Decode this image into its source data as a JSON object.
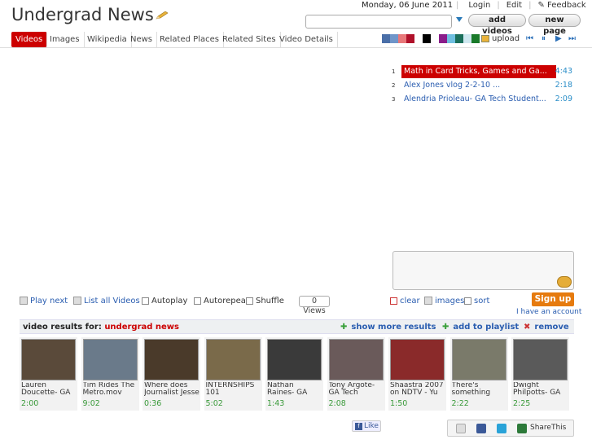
{
  "header": {
    "title": "Undergrad News",
    "date": "Monday, 06 June 2011",
    "links": [
      "Login",
      "Edit",
      "Feedback"
    ],
    "search_placeholder": "",
    "add_videos": "add videos",
    "new_page": "new page"
  },
  "tabs": [
    "Videos",
    "Images",
    "Wikipedia",
    "News",
    "Related Places",
    "Related Sites",
    "Video Details"
  ],
  "swatch_colors": [
    "#4a6fa8",
    "#6f95c9",
    "#e8787a",
    "#b0112a",
    "#ffffff",
    "#000000",
    "#ffffff",
    "#8a1d8a",
    "#6fbfe0",
    "#1a6f5a",
    "#cfe8f0",
    "#1a7a2a"
  ],
  "upload_label": "upload",
  "player_controls": [
    "⏮",
    "⏸",
    "▶",
    "⏭"
  ],
  "playlist": [
    {
      "num": "1",
      "title": "Math in Card Tricks, Games and Ga...",
      "duration": "4:43",
      "active": true
    },
    {
      "num": "2",
      "title": "Alex Jones vlog 2-2-10             ...",
      "duration": "2:18",
      "active": false
    },
    {
      "num": "3",
      "title": "Alendria Prioleau- GA Tech Student...",
      "duration": "2:09",
      "active": false
    }
  ],
  "controls": {
    "play_next": "Play next",
    "list_all": "List all Videos",
    "autoplay": "Autoplay",
    "autorepeat": "Autorepeat",
    "shuffle": "Shuffle",
    "views": "0 Views",
    "clear": "clear",
    "images": "images",
    "sort": "sort",
    "sign_up": "Sign up",
    "have_account": "I have an account"
  },
  "results": {
    "label": "video results for:",
    "query": "undergrad news",
    "show_more": "show more results",
    "add_playlist": "add to playlist",
    "remove": "remove"
  },
  "videos": [
    {
      "caption": "Lauren Doucette- GA",
      "duration": "2:00",
      "bg": "#5a4a3a"
    },
    {
      "caption": "Tim Rides The Metro.mov",
      "duration": "9:02",
      "bg": "#6a7a8a"
    },
    {
      "caption": "Where does Journalist Jesse",
      "duration": "0:36",
      "bg": "#4a3a2a"
    },
    {
      "caption": "INTERNSHIPS 101",
      "duration": "5:02",
      "bg": "#7a6a4a"
    },
    {
      "caption": "Nathan Raines- GA",
      "duration": "1:43",
      "bg": "#3a3a3a"
    },
    {
      "caption": "Tony Argote- GA Tech",
      "duration": "2:08",
      "bg": "#6a5a5a"
    },
    {
      "caption": "Shaastra 2007 on NDTV - Yu",
      "duration": "1:50",
      "bg": "#8a2a2a"
    },
    {
      "caption": "There's something",
      "duration": "2:22",
      "bg": "#7a7a6a"
    },
    {
      "caption": "Dwight Philpotts- GA",
      "duration": "2:25",
      "bg": "#5a5a5a"
    }
  ],
  "social": {
    "like": "Like",
    "share": "ShareThis"
  }
}
